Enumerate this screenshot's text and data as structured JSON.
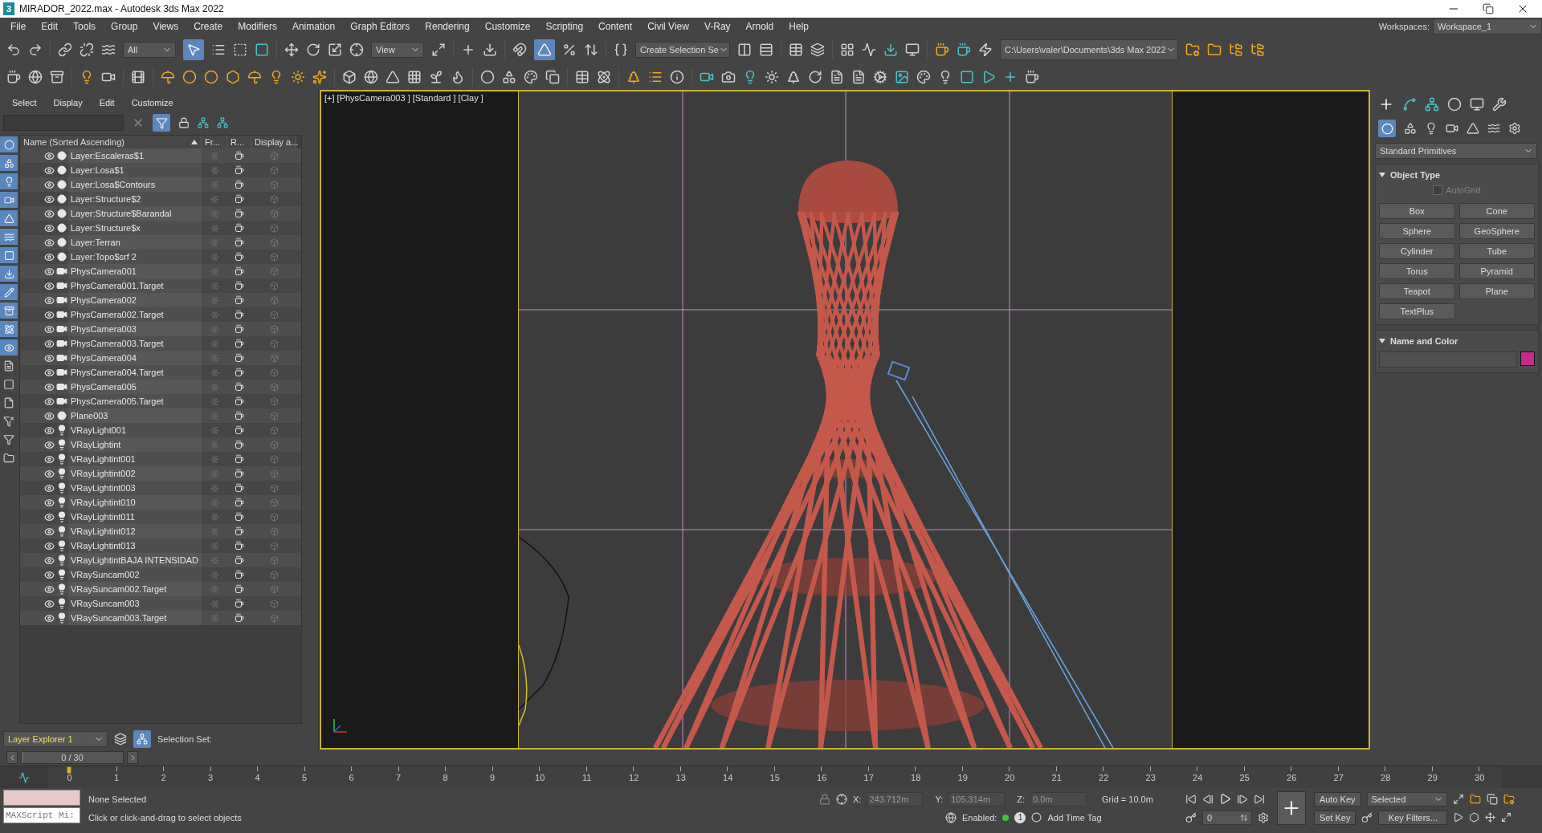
{
  "window": {
    "logo": "3",
    "title": "MIRADOR_2022.max - Autodesk 3ds Max 2022"
  },
  "menu": [
    "File",
    "Edit",
    "Tools",
    "Group",
    "Views",
    "Create",
    "Modifiers",
    "Animation",
    "Graph Editors",
    "Rendering",
    "Customize",
    "Scripting",
    "Content",
    "Civil View",
    "V-Ray",
    "Arnold",
    "Help"
  ],
  "workspaces": {
    "label": "Workspaces:",
    "value": "Workspace_1"
  },
  "toolbar": {
    "selection_filter": "All",
    "reference_coordinate": "View",
    "named_selection": "Create Selection Se",
    "project_path": "C:\\Users\\valer\\Documents\\3ds Max 2022"
  },
  "explorer": {
    "menu": [
      "Select",
      "Display",
      "Edit",
      "Customize"
    ],
    "columns": [
      "Name (Sorted Ascending)",
      "Fr...",
      "R...",
      "Display a..."
    ],
    "rows": [
      {
        "name": "Layer:Escaleras$1",
        "kind": "layer"
      },
      {
        "name": "Layer:Losa$1",
        "kind": "layer"
      },
      {
        "name": "Layer:Losa$Contours",
        "kind": "layer"
      },
      {
        "name": "Layer:Structure$2",
        "kind": "layer"
      },
      {
        "name": "Layer:Structure$Barandal",
        "kind": "layer"
      },
      {
        "name": "Layer:Structure$x",
        "kind": "layer"
      },
      {
        "name": "Layer:Terran",
        "kind": "layer"
      },
      {
        "name": "Layer:Topo$srf 2",
        "kind": "layer"
      },
      {
        "name": "PhysCamera001",
        "kind": "camera"
      },
      {
        "name": "PhysCamera001.Target",
        "kind": "camera"
      },
      {
        "name": "PhysCamera002",
        "kind": "camera"
      },
      {
        "name": "PhysCamera002.Target",
        "kind": "camera"
      },
      {
        "name": "PhysCamera003",
        "kind": "camera"
      },
      {
        "name": "PhysCamera003.Target",
        "kind": "camera"
      },
      {
        "name": "PhysCamera004",
        "kind": "camera"
      },
      {
        "name": "PhysCamera004.Target",
        "kind": "camera"
      },
      {
        "name": "PhysCamera005",
        "kind": "camera"
      },
      {
        "name": "PhysCamera005.Target",
        "kind": "camera"
      },
      {
        "name": "Plane003",
        "kind": "layer"
      },
      {
        "name": "VRayLight001",
        "kind": "light"
      },
      {
        "name": "VRayLightint",
        "kind": "light"
      },
      {
        "name": "VRayLightint001",
        "kind": "light"
      },
      {
        "name": "VRayLightint002",
        "kind": "light"
      },
      {
        "name": "VRayLightint003",
        "kind": "light"
      },
      {
        "name": "VRayLightint010",
        "kind": "light"
      },
      {
        "name": "VRayLightint011",
        "kind": "light"
      },
      {
        "name": "VRayLightint012",
        "kind": "light"
      },
      {
        "name": "VRayLightint013",
        "kind": "light"
      },
      {
        "name": "VRayLightintBAJA INTENSIDAD",
        "kind": "light"
      },
      {
        "name": "VRaySuncam002",
        "kind": "light"
      },
      {
        "name": "VRaySuncam002.Target",
        "kind": "light"
      },
      {
        "name": "VRaySuncam003",
        "kind": "light"
      },
      {
        "name": "VRaySuncam003.Target",
        "kind": "light"
      }
    ],
    "explorer_name": "Layer Explorer 1",
    "selection_set_label": "Selection Set:"
  },
  "viewport": {
    "label": "[+] [PhysCamera003 ] [Standard ] [Clay ]"
  },
  "command_panel": {
    "category": "Standard Primitives",
    "object_type_title": "Object Type",
    "autogrid": {
      "label": "AutoGrid",
      "checked": false,
      "disabled": true
    },
    "buttons": [
      "Box",
      "Cone",
      "Sphere",
      "GeoSphere",
      "Cylinder",
      "Tube",
      "Torus",
      "Pyramid",
      "Teapot",
      "Plane",
      "TextPlus"
    ],
    "name_color_title": "Name and Color",
    "color": "#c8288c"
  },
  "timeline": {
    "frame": "0 / 30",
    "level": 0,
    "ticks": [
      "0",
      "1",
      "2",
      "3",
      "4",
      "5",
      "6",
      "7",
      "8",
      "9",
      "10",
      "11",
      "12",
      "13",
      "14",
      "15",
      "16",
      "17",
      "18",
      "19",
      "20",
      "21",
      "22",
      "23",
      "24",
      "25",
      "26",
      "27",
      "28",
      "29",
      "30"
    ]
  },
  "status": {
    "maxscript_placeholder": "MAXScript Mi:",
    "selection": "None Selected",
    "prompt": "Click or click-and-drag to select objects",
    "x_label": "X:",
    "x": "243.712m",
    "y_label": "Y:",
    "y": "105.314m",
    "z_label": "Z:",
    "z": "0.0m",
    "grid": "Grid = 10.0m",
    "enabled_label": "Enabled:",
    "tag_count": "1",
    "add_time_tag": "Add Time Tag",
    "auto_key": "Auto Key",
    "key_mode": "Selected",
    "frame_spinner": "0",
    "set_key": "Set Key",
    "key_filters": "Key Filters..."
  }
}
